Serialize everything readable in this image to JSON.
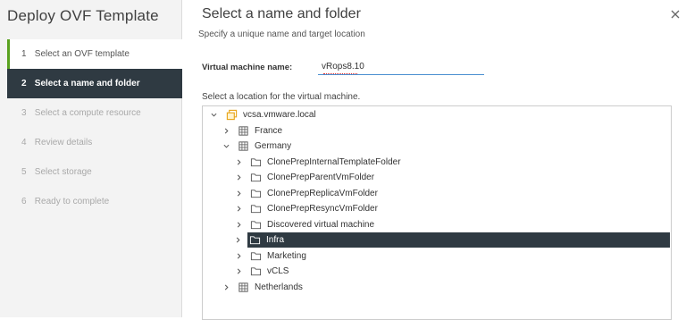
{
  "wizard": {
    "title": "Deploy OVF Template"
  },
  "steps": [
    {
      "num": "1",
      "label": "Select an OVF template",
      "state": "completed"
    },
    {
      "num": "2",
      "label": "Select a name and folder",
      "state": "active"
    },
    {
      "num": "3",
      "label": "Select a compute resource",
      "state": "disabled"
    },
    {
      "num": "4",
      "label": "Review details",
      "state": "disabled"
    },
    {
      "num": "5",
      "label": "Select storage",
      "state": "disabled"
    },
    {
      "num": "6",
      "label": "Ready to complete",
      "state": "disabled"
    }
  ],
  "page": {
    "title": "Select a name and folder",
    "subtitle": "Specify a unique name and target location"
  },
  "vm_name": {
    "label": "Virtual machine name:",
    "value": "vRops8.10"
  },
  "location": {
    "label": "Select a location for the virtual machine."
  },
  "tree": [
    {
      "label": "vcsa.vmware.local",
      "icon": "vcenter-icon",
      "expanded": true
    },
    {
      "label": "France",
      "icon": "datacenter-icon",
      "expanded": false
    },
    {
      "label": "Germany",
      "icon": "datacenter-icon",
      "expanded": true
    },
    {
      "label": "ClonePrepInternalTemplateFolder",
      "icon": "folder-icon",
      "expanded": false
    },
    {
      "label": "ClonePrepParentVmFolder",
      "icon": "folder-icon",
      "expanded": false
    },
    {
      "label": "ClonePrepReplicaVmFolder",
      "icon": "folder-icon",
      "expanded": false
    },
    {
      "label": "ClonePrepResyncVmFolder",
      "icon": "folder-icon",
      "expanded": false
    },
    {
      "label": "Discovered virtual machine",
      "icon": "folder-icon",
      "expanded": false
    },
    {
      "label": "Infra",
      "icon": "folder-icon",
      "expanded": false,
      "selected": true
    },
    {
      "label": "Marketing",
      "icon": "folder-icon",
      "expanded": false
    },
    {
      "label": "vCLS",
      "icon": "folder-icon",
      "expanded": false
    },
    {
      "label": "Netherlands",
      "icon": "datacenter-icon",
      "expanded": false
    }
  ],
  "colors": {
    "selected_bg": "#2f3a42",
    "completed_accent": "#5aa220",
    "input_underline": "#4a8fd1",
    "vcenter_icon": "#e8a317"
  }
}
